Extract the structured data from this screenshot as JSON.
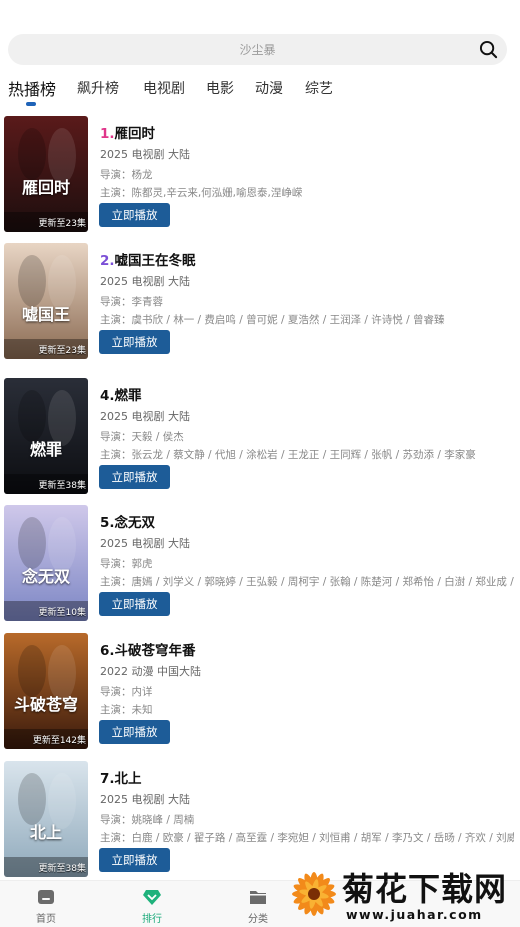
{
  "search": {
    "placeholder": "沙尘暴"
  },
  "tabs": [
    {
      "label": "热播榜",
      "active": true
    },
    {
      "label": "飙升榜"
    },
    {
      "label": "电视剧"
    },
    {
      "label": "电影"
    },
    {
      "label": "动漫"
    },
    {
      "label": "综艺"
    }
  ],
  "play_label": "立即播放",
  "items": [
    {
      "rank": "1.",
      "rank_color": "#e0358a",
      "title": "雁回时",
      "meta": "2025  电视剧  大陆",
      "director": "导演：杨龙",
      "cast": "主演：陈都灵,辛云来,何泓姗,喻恩泰,涅峥嵘",
      "poster_text": "雁回时",
      "poster_badge": "更新至23集",
      "poster_colors": [
        "#5a1a1a",
        "#1c0e0e"
      ]
    },
    {
      "rank": "2.",
      "rank_color": "#7b4fd6",
      "title": "嘘国王在冬眠",
      "meta": "2025  电视剧  大陆",
      "director": "导演：李青蓉",
      "cast": "主演：虞书欣 / 林一 / 费启鸣 / 曾可妮 / 夏浩然 / 王润泽 / 许诗悦 / 曾睿臻",
      "poster_text": "嘘国王",
      "poster_badge": "更新至23集",
      "poster_colors": [
        "#e8d5c4",
        "#8a6a52"
      ]
    },
    {
      "rank": "4.",
      "rank_color": "#111111",
      "title": "燃罪",
      "meta": "2025  电视剧  大陆",
      "director": "导演：天毅 / 侯杰",
      "cast": "主演：张云龙 / 蔡文静 / 代旭 / 涂松岩 / 王龙正 / 王同辉 / 张帆 / 苏劲添 / 李家豪",
      "poster_text": "燃罪",
      "poster_badge": "更新至38集",
      "poster_colors": [
        "#2a2e38",
        "#0c0d11"
      ]
    },
    {
      "rank": "5.",
      "rank_color": "#111111",
      "title": "念无双",
      "meta": "2025  电视剧  大陆",
      "director": "导演：郭虎",
      "cast": "主演：唐嫣 / 刘学义 / 郭晓婷 / 王弘毅 / 周柯宇 / 张翰 / 陈楚河 / 郑希怡 / 白澍 / 郑业成 / …",
      "poster_text": "念无双",
      "poster_badge": "更新至10集",
      "poster_colors": [
        "#cfc8ea",
        "#7c86c4"
      ]
    },
    {
      "rank": "6.",
      "rank_color": "#111111",
      "title": "斗破苍穹年番",
      "meta": "2022  动漫  中国大陆",
      "director": "导演：内详",
      "cast": "主演：未知",
      "poster_text": "斗破苍穹",
      "poster_badge": "更新至142集",
      "poster_colors": [
        "#b86a2a",
        "#3a1a0c"
      ]
    },
    {
      "rank": "7.",
      "rank_color": "#111111",
      "title": "北上",
      "meta": "2025  电视剧  大陆",
      "director": "导演：姚晓峰 / 周楠",
      "cast": "主演：白鹿 / 欧豪 / 翟子路 / 高至霆 / 李宛妲 / 刘恒甫 / 胡军 / 李乃文 / 岳旸 / 齐欢 / 刘威…",
      "poster_text": "北上",
      "poster_badge": "更新至38集",
      "poster_colors": [
        "#d9e4ec",
        "#8fa9bb"
      ]
    }
  ],
  "bottom_nav": [
    {
      "label": "首页",
      "icon": "home-icon"
    },
    {
      "label": "排行",
      "icon": "rank-diamond-icon",
      "active": true
    },
    {
      "label": "分类",
      "icon": "folder-icon"
    }
  ],
  "watermark": {
    "title": "菊花下载网",
    "url": "www.juahar.com"
  }
}
